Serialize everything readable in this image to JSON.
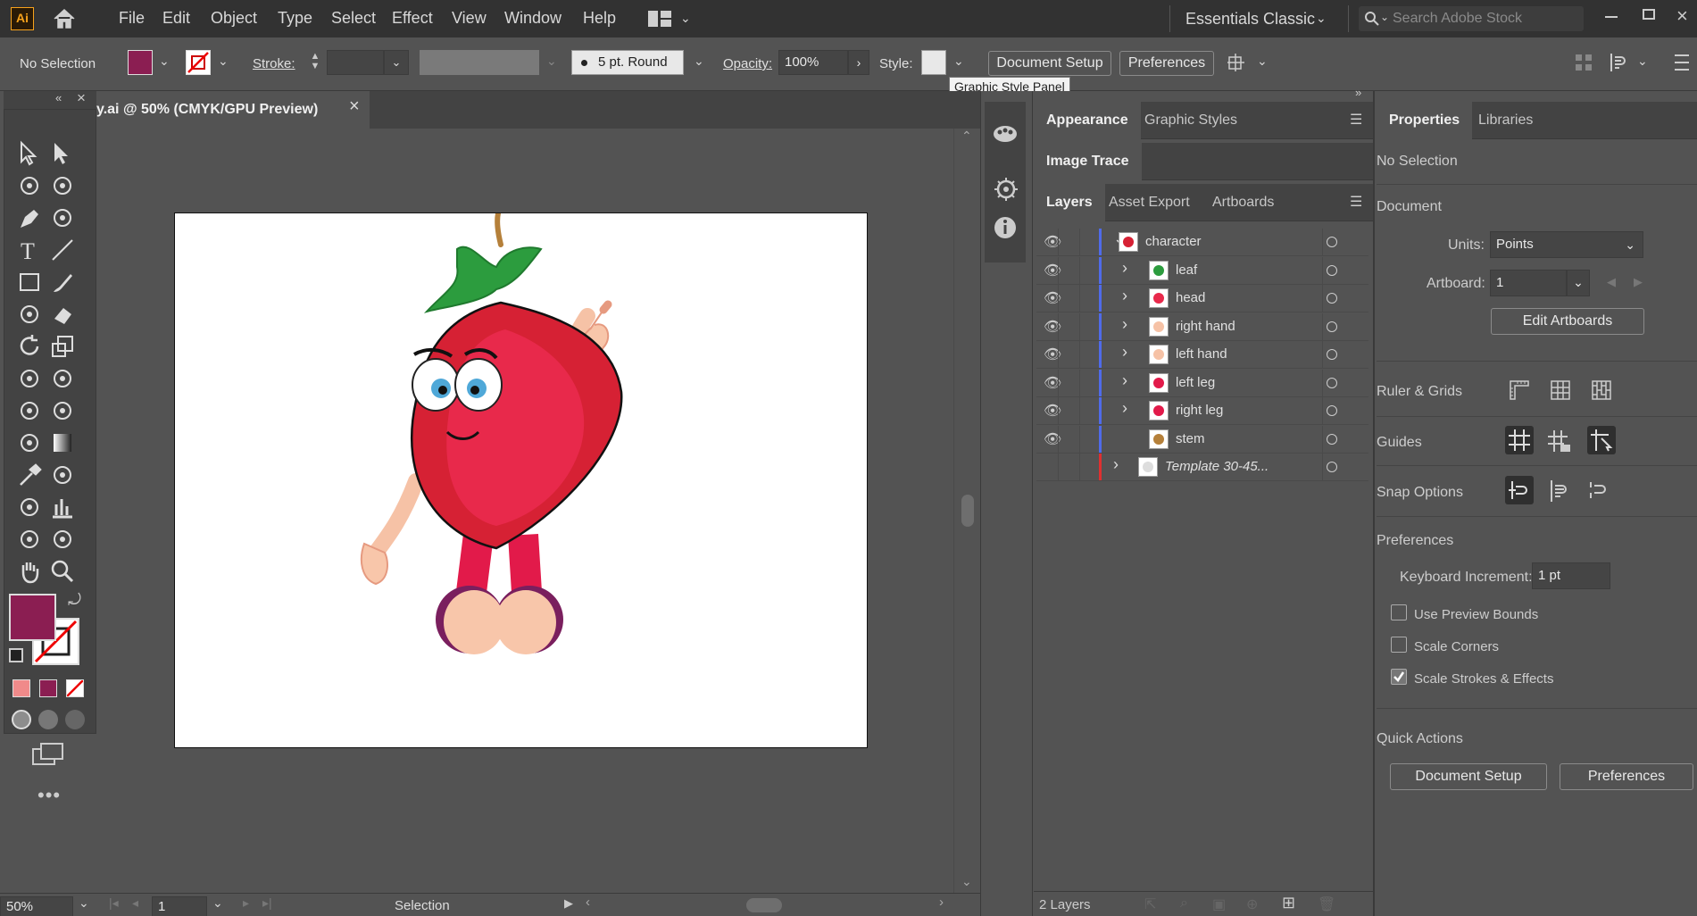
{
  "app": {
    "logo": "Ai",
    "workspace": "Essentials Classic",
    "search_placeholder": "Search Adobe Stock"
  },
  "menu": [
    "File",
    "Edit",
    "Object",
    "Type",
    "Select",
    "Effect",
    "View",
    "Window",
    "Help"
  ],
  "control": {
    "selection": "No Selection",
    "stroke_label": "Stroke:",
    "brush": "5 pt. Round",
    "opacity_label": "Opacity:",
    "opacity_value": "100%",
    "style_label": "Style:",
    "doc_setup": "Document Setup",
    "preferences": "Preferences",
    "tooltip": "Graphic Style Panel",
    "fill_color": "#8b1e52"
  },
  "doc_tab": {
    "title": "y.ai @ 50% (CMYK/GPU Preview)",
    "close": "×"
  },
  "status": {
    "zoom": "50%",
    "artboard": "1",
    "tool": "Selection"
  },
  "panels": {
    "group1_tabs": [
      "Appearance",
      "Graphic Styles"
    ],
    "image_trace": "Image Trace",
    "group2_tabs": [
      "Layers",
      "Asset Export",
      "Artboards"
    ],
    "layers": [
      {
        "name": "character",
        "level": 0
      },
      {
        "name": "leaf",
        "level": 1
      },
      {
        "name": "head",
        "level": 1
      },
      {
        "name": "right hand",
        "level": 1
      },
      {
        "name": "left hand",
        "level": 1
      },
      {
        "name": "left leg",
        "level": 1
      },
      {
        "name": "right leg",
        "level": 1
      },
      {
        "name": "stem",
        "level": 1
      },
      {
        "name": "Template 30-45...",
        "level": 0
      }
    ],
    "layers_count": "2 Layers"
  },
  "properties": {
    "tabs": [
      "Properties",
      "Libraries"
    ],
    "no_selection": "No Selection",
    "document": "Document",
    "units_label": "Units:",
    "units_value": "Points",
    "artboard_label": "Artboard:",
    "artboard_value": "1",
    "edit_artboards": "Edit Artboards",
    "ruler_grids": "Ruler & Grids",
    "guides": "Guides",
    "snap_options": "Snap Options",
    "preferences": "Preferences",
    "kbd_label": "Keyboard Increment:",
    "kbd_value": "1 pt",
    "use_preview_bounds": "Use Preview Bounds",
    "scale_corners": "Scale Corners",
    "scale_strokes": "Scale Strokes & Effects",
    "quick_actions": "Quick Actions",
    "qa_doc_setup": "Document Setup",
    "qa_preferences": "Preferences"
  }
}
